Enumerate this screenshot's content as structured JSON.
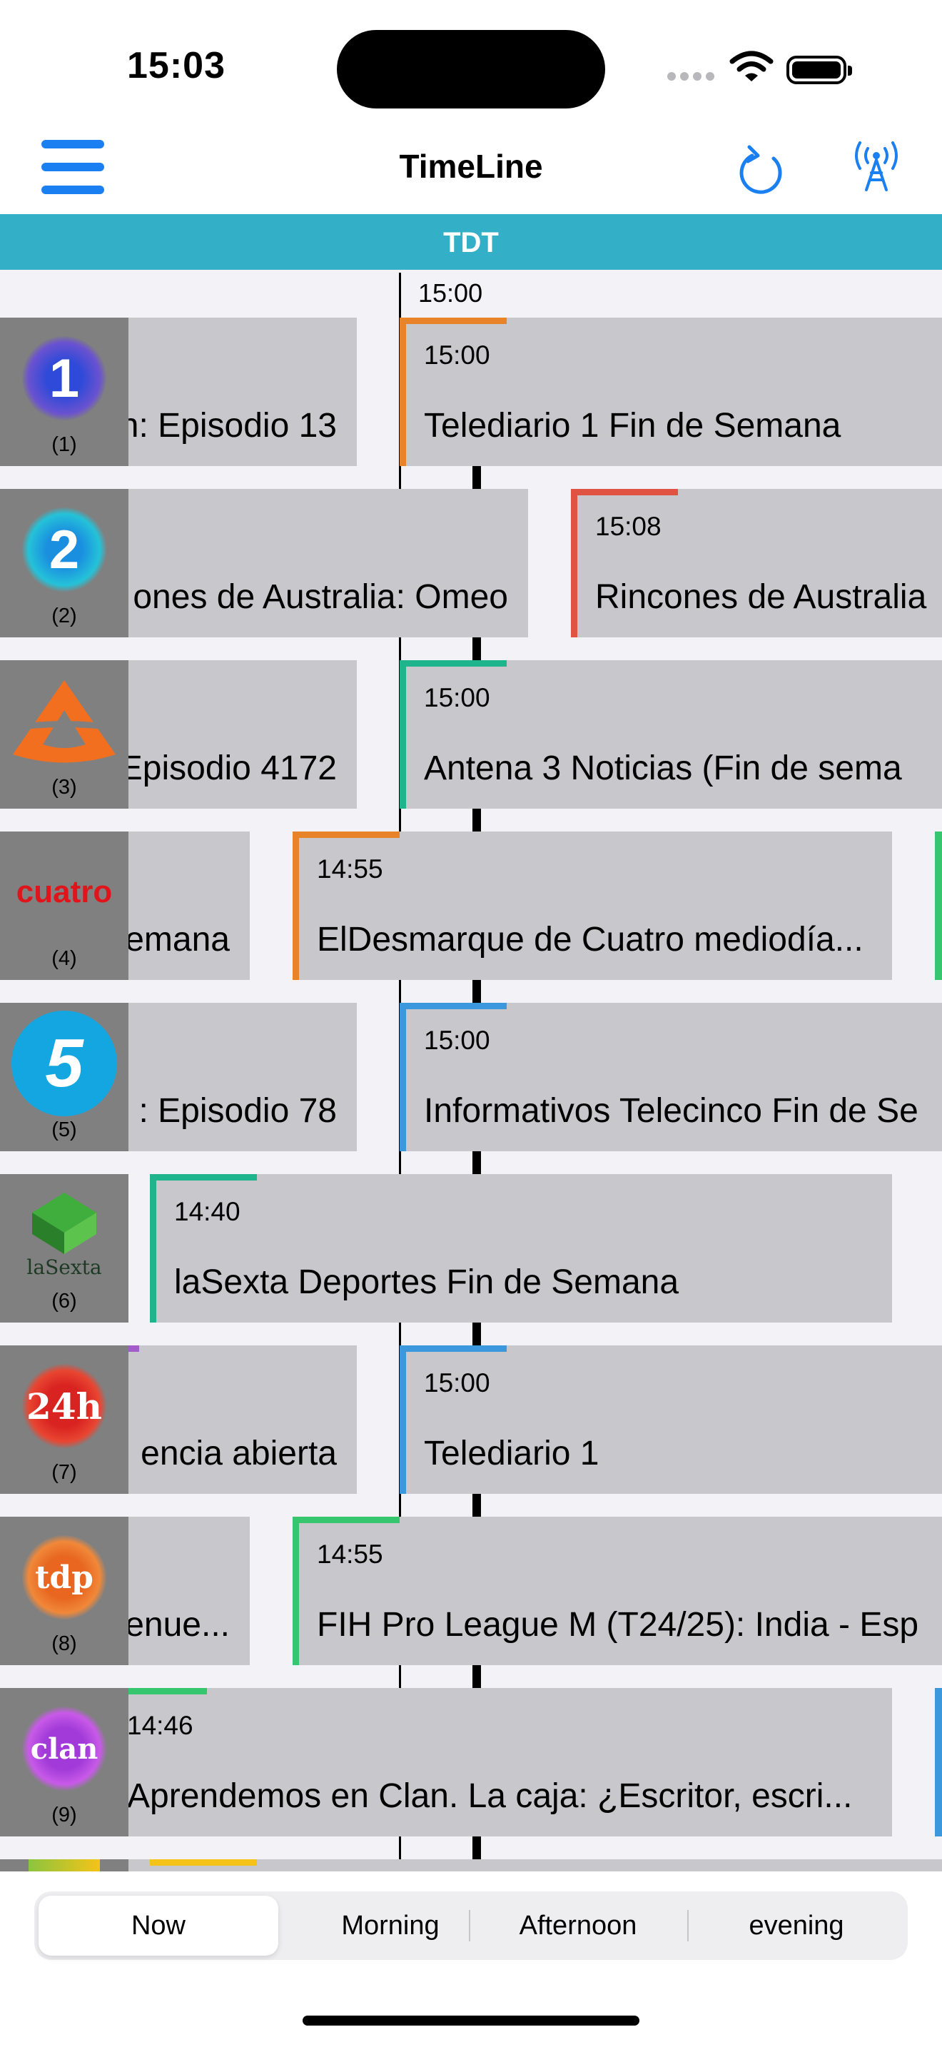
{
  "status_bar": {
    "time": "15:03"
  },
  "nav": {
    "title": "TimeLine",
    "menu_icon": "hamburger-icon",
    "refresh_icon": "refresh-icon",
    "antenna_icon": "antenna-icon"
  },
  "band": {
    "label": "TDT"
  },
  "timeline": {
    "current_time": "15:00"
  },
  "colors": {
    "accent": "#1a7ff0",
    "band": "#33afc8",
    "orange": "#e8832a",
    "red": "#e05343",
    "teal": "#1fb58c",
    "blue": "#3b98dc",
    "green": "#36c76e",
    "purple": "#a45cc8",
    "yellow": "#f5c318"
  },
  "channels": [
    {
      "number": "(1)",
      "logo": "1",
      "prev_title": "n: Episodio 13",
      "time": "15:00",
      "title": "Telediario 1 Fin de Semana"
    },
    {
      "number": "(2)",
      "logo": "2",
      "prev_title": "ones de Australia: Omeo",
      "time": "15:08",
      "title": "Rincones de Australia"
    },
    {
      "number": "(3)",
      "logo": "antena3-logo",
      "prev_title": "Episodio 4172",
      "time": "15:00",
      "title": "Antena 3 Noticias  (Fin de sema"
    },
    {
      "number": "(4)",
      "logo": "cuatro",
      "prev_title": "emana",
      "time": "14:55",
      "title": "ElDesmarque de Cuatro mediodía..."
    },
    {
      "number": "(5)",
      "logo": "5",
      "prev_title": ": Episodio 78",
      "time": "15:00",
      "title": "Informativos Telecinco Fin de Se"
    },
    {
      "number": "(6)",
      "logo": "laSexta",
      "time": "14:40",
      "title": "laSexta Deportes Fin de Semana"
    },
    {
      "number": "(7)",
      "logo": "24h",
      "prev_title": "encia abierta",
      "time": "15:00",
      "title": "Telediario 1"
    },
    {
      "number": "(8)",
      "logo": "tdp",
      "prev_title": "enue...",
      "time": "14:55",
      "title": "FIH Pro League M (T24/25): India - Esp"
    },
    {
      "number": "(9)",
      "logo": "clan",
      "time": "14:46",
      "title": "Aprendemos en Clan. La caja: ¿Escritor, escri..."
    }
  ],
  "tabs": [
    "Now",
    "Morning",
    "Afternoon",
    "evening"
  ],
  "selected_tab": "Now"
}
